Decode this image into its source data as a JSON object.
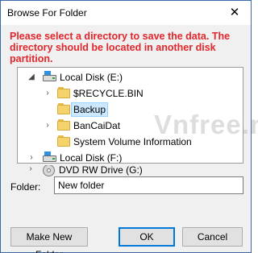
{
  "window": {
    "title": "Browse For Folder",
    "close_glyph": "✕"
  },
  "instructions": "Please select a directory to save the data. The directory should be located in another disk partition.",
  "tree": {
    "items": [
      {
        "label": "Local Disk (E:)",
        "icon": "drive-icon",
        "expanded": true
      },
      {
        "label": "$RECYCLE.BIN",
        "icon": "folder-icon",
        "expanded": false
      },
      {
        "label": "Backup",
        "icon": "folder-icon",
        "selected": true
      },
      {
        "label": "BanCaiDat",
        "icon": "folder-icon",
        "expanded": false
      },
      {
        "label": "System Volume Information",
        "icon": "folder-icon"
      },
      {
        "label": "Local Disk (F:)",
        "icon": "drive-icon",
        "expanded": false
      },
      {
        "label": "DVD RW Drive (G:)",
        "icon": "dvd-icon",
        "expanded": false
      }
    ]
  },
  "watermark": "Vnfree.net",
  "folder": {
    "label": "Folder:",
    "value": "New folder"
  },
  "buttons": {
    "new_folder": "Make New Folder",
    "ok": "OK",
    "cancel": "Cancel"
  },
  "colors": {
    "instructions": "#e3262b",
    "selection": "#cce8ff",
    "default_button_border": "#0078d7"
  }
}
